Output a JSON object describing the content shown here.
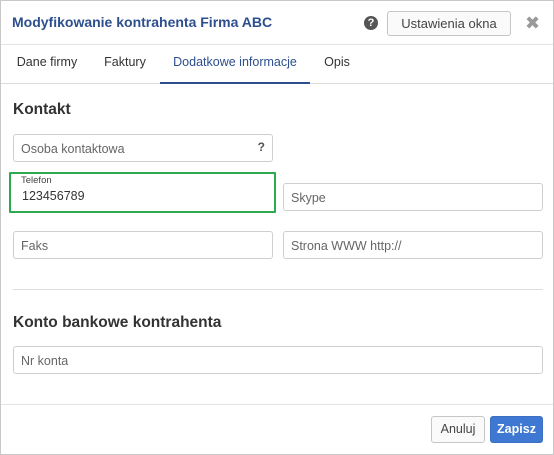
{
  "dialog": {
    "title": "Modyfikowanie kontrahenta Firma ABC",
    "help_icon": "?",
    "settings_label": "Ustawienia okna",
    "close_icon": "✖"
  },
  "tabs": [
    {
      "label": "Dane firmy",
      "active": false
    },
    {
      "label": "Faktury",
      "active": false
    },
    {
      "label": "Dodatkowe informacje",
      "active": true
    },
    {
      "label": "Opis",
      "active": false
    }
  ],
  "contact": {
    "title": "Kontakt",
    "contact_person": {
      "placeholder": "Osoba kontaktowa",
      "hint_icon": "?"
    },
    "phone": {
      "label": "Telefon",
      "value": "123456789"
    },
    "skype": {
      "placeholder": "Skype"
    },
    "fax": {
      "placeholder": "Faks"
    },
    "website": {
      "placeholder": "Strona WWW http://"
    }
  },
  "bank": {
    "title": "Konto bankowe kontrahenta",
    "account": {
      "placeholder": "Nr konta"
    }
  },
  "footer": {
    "cancel_label": "Anuluj",
    "save_label": "Zapisz"
  },
  "colors": {
    "accent": "#2d4f8e",
    "primary_button": "#3f78d2",
    "focus_border": "#2fa84f"
  }
}
